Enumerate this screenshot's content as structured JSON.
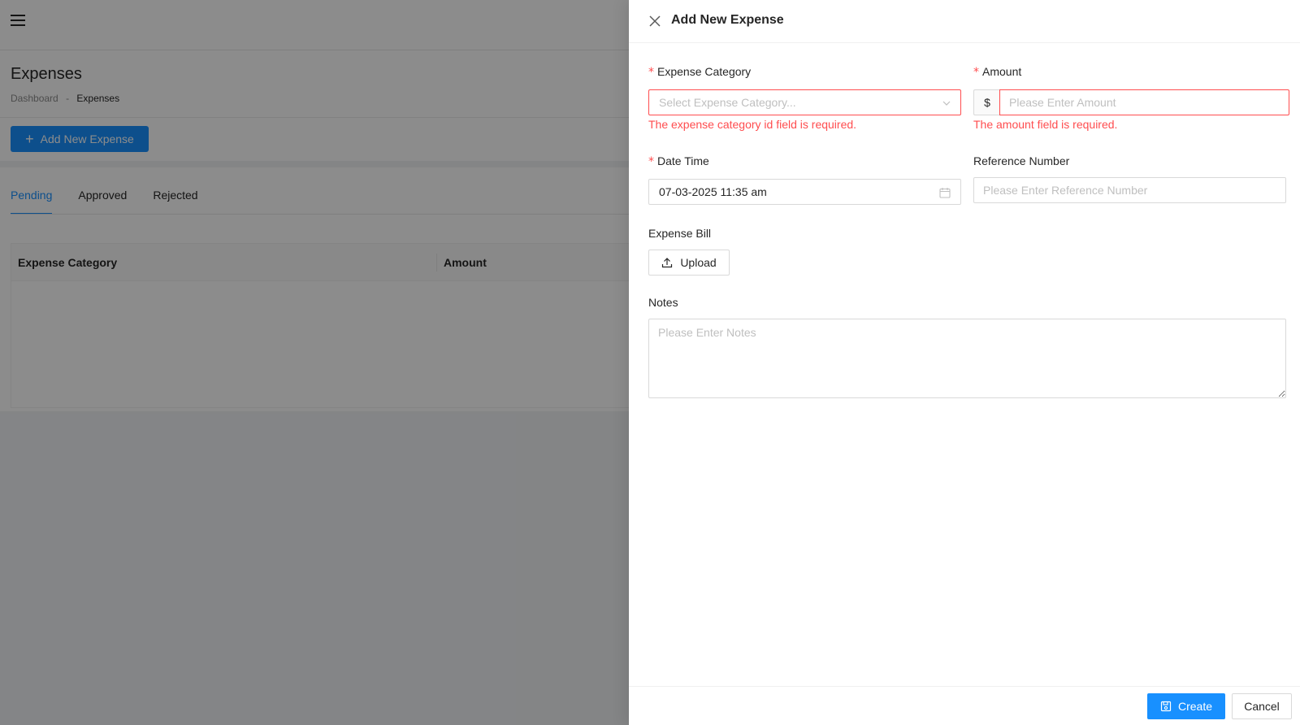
{
  "page": {
    "title": "Expenses",
    "breadcrumb": {
      "home": "Dashboard",
      "separator": "-",
      "current": "Expenses"
    },
    "add_button_label": "Add New Expense",
    "tabs": [
      {
        "label": "Pending",
        "active": true
      },
      {
        "label": "Approved",
        "active": false
      },
      {
        "label": "Rejected",
        "active": false
      }
    ],
    "table": {
      "columns": [
        "Expense Category",
        "Amount"
      ]
    }
  },
  "drawer": {
    "title": "Add New Expense",
    "fields": {
      "expense_category": {
        "label": "Expense Category",
        "required": "*",
        "placeholder": "Select Expense Category...",
        "error": "The expense category id field is required."
      },
      "amount": {
        "label": "Amount",
        "required": "*",
        "prefix": "$",
        "placeholder": "Please Enter Amount",
        "error": "The amount field is required."
      },
      "date_time": {
        "label": "Date Time",
        "required": "*",
        "value": "07-03-2025 11:35 am"
      },
      "reference_number": {
        "label": "Reference Number",
        "placeholder": "Please Enter Reference Number"
      },
      "expense_bill": {
        "label": "Expense Bill",
        "button": "Upload"
      },
      "notes": {
        "label": "Notes",
        "placeholder": "Please Enter Notes"
      }
    },
    "footer": {
      "create_label": "Create",
      "cancel_label": "Cancel"
    }
  },
  "colors": {
    "primary": "#1890ff",
    "error": "#ff4d4f",
    "border": "#d9d9d9",
    "placeholder": "#bfbfbf"
  }
}
